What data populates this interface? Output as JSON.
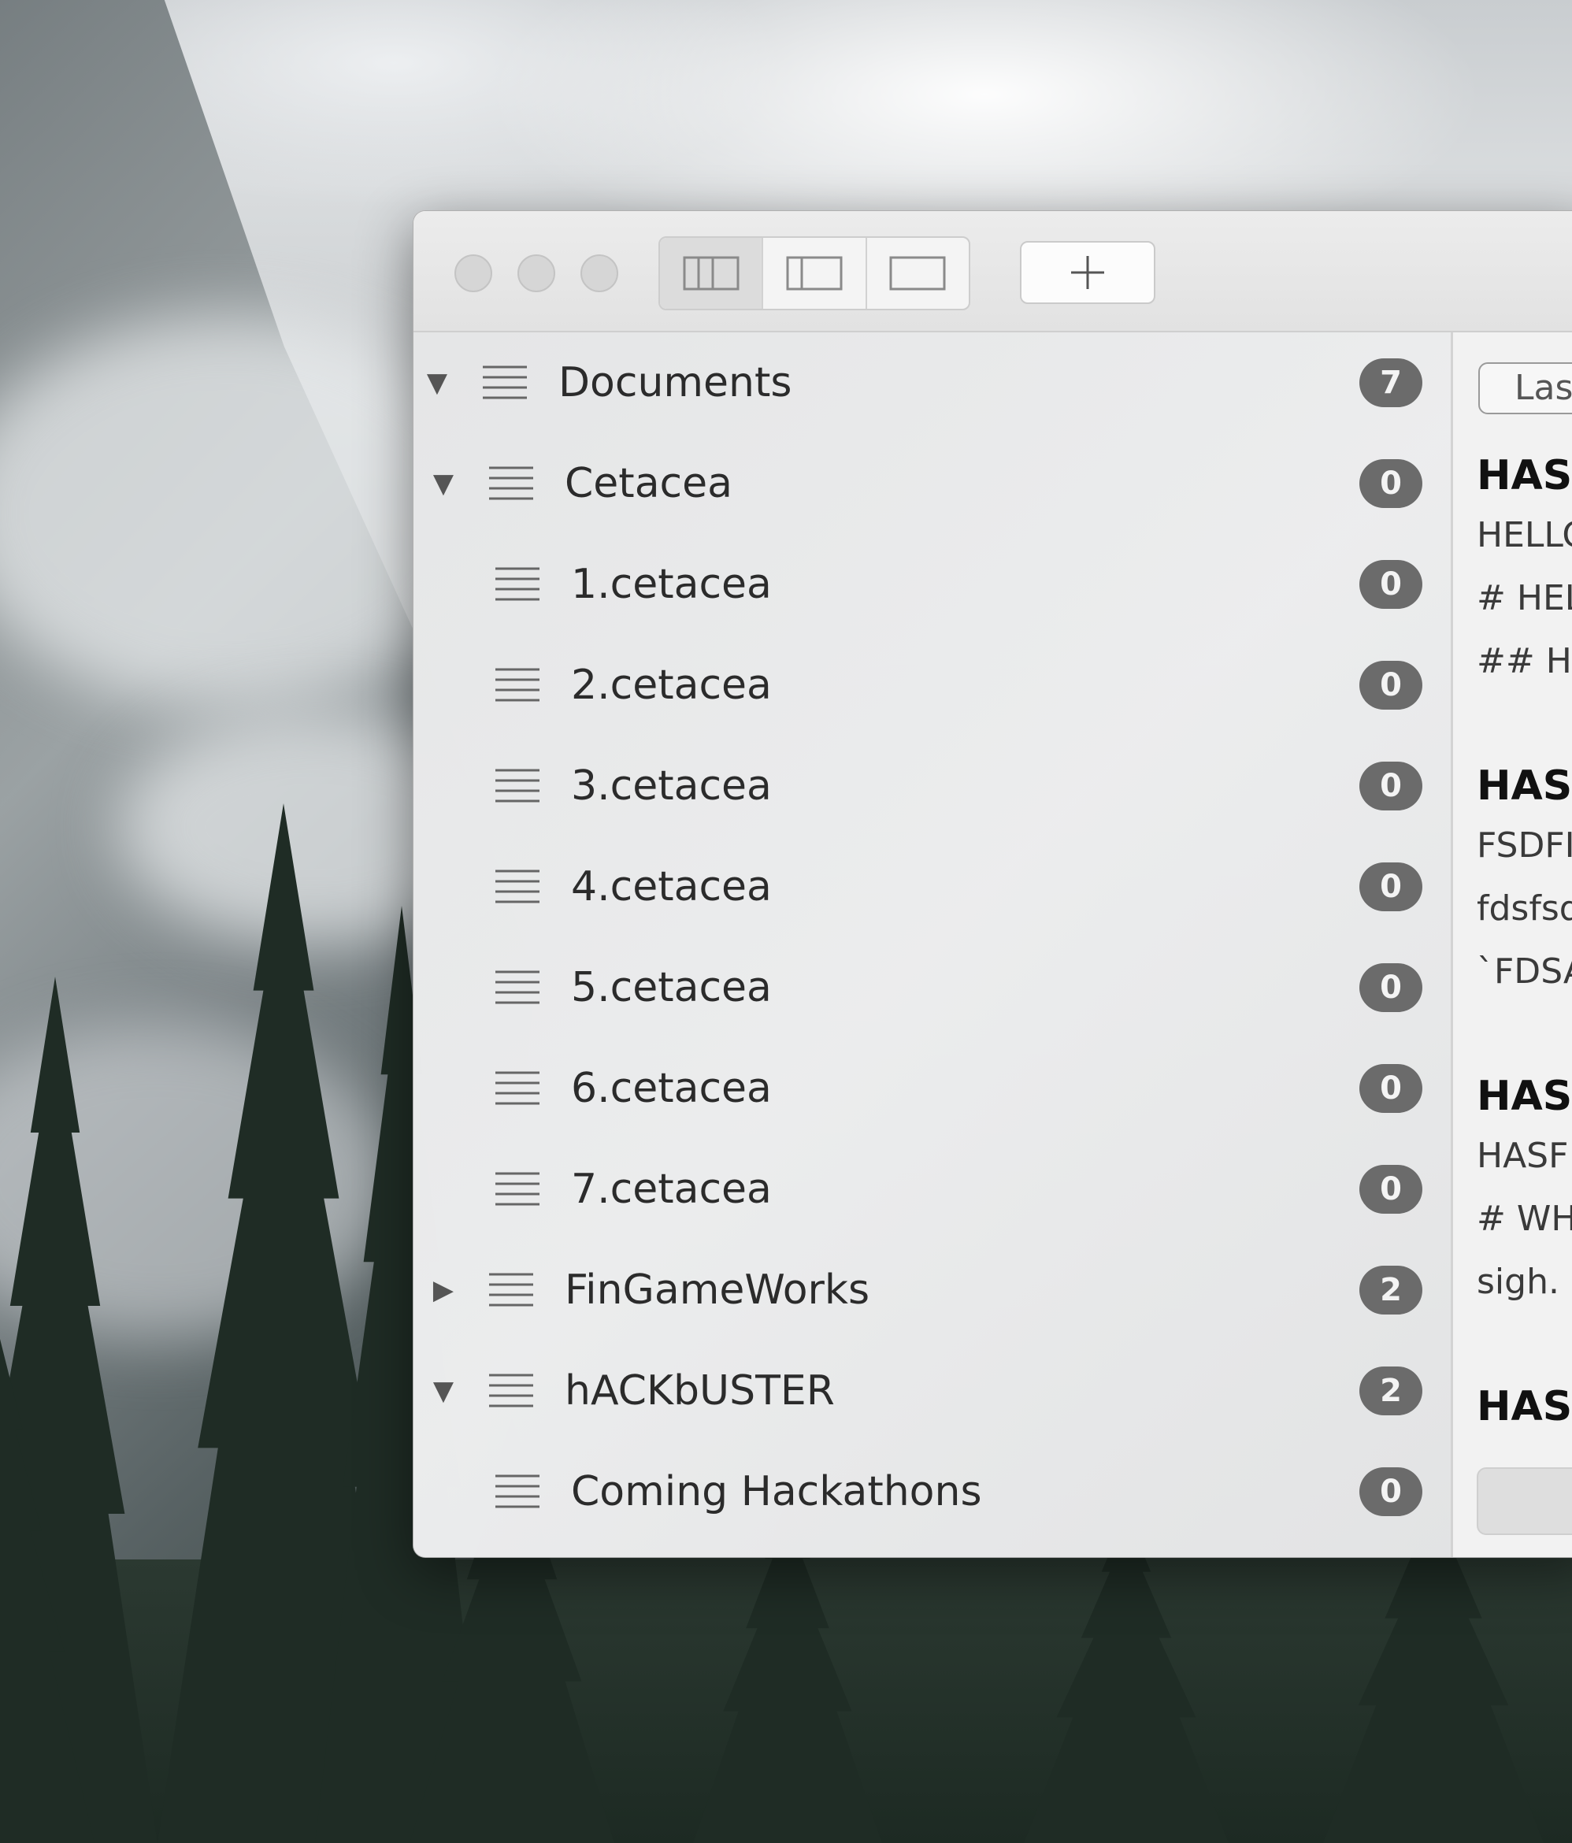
{
  "toolbar": {
    "view_modes": [
      {
        "icon": "three-pane-icon"
      },
      {
        "icon": "two-pane-icon"
      },
      {
        "icon": "single-pane-icon"
      }
    ],
    "add_icon": "plus-icon"
  },
  "sidebar": {
    "items": [
      {
        "label": "Documents",
        "count": "7",
        "disclosure": "▼"
      },
      {
        "label": "Cetacea",
        "count": "0",
        "disclosure": "▼"
      },
      {
        "label": "1.cetacea",
        "count": "0",
        "disclosure": ""
      },
      {
        "label": "2.cetacea",
        "count": "0",
        "disclosure": ""
      },
      {
        "label": "3.cetacea",
        "count": "0",
        "disclosure": ""
      },
      {
        "label": "4.cetacea",
        "count": "0",
        "disclosure": ""
      },
      {
        "label": "5.cetacea",
        "count": "0",
        "disclosure": ""
      },
      {
        "label": "6.cetacea",
        "count": "0",
        "disclosure": ""
      },
      {
        "label": "7.cetacea",
        "count": "0",
        "disclosure": ""
      },
      {
        "label": "FinGameWorks",
        "count": "2",
        "disclosure": "▶"
      },
      {
        "label": "hACKbUSTER",
        "count": "2",
        "disclosure": "▼"
      },
      {
        "label": "Coming Hackathons",
        "count": "0",
        "disclosure": ""
      }
    ]
  },
  "notes": {
    "sort_label": "Las",
    "items": [
      {
        "title": "HASS",
        "lines": [
          "HELLO",
          "# HEL",
          "## HE"
        ]
      },
      {
        "title": "HASS",
        "lines": [
          "FSDFI",
          "fdsfsd",
          "`FDSA"
        ]
      },
      {
        "title": "HASS",
        "lines": [
          "HASF",
          "# WHY",
          "sigh."
        ]
      },
      {
        "title": "HASS",
        "lines": []
      }
    ]
  }
}
